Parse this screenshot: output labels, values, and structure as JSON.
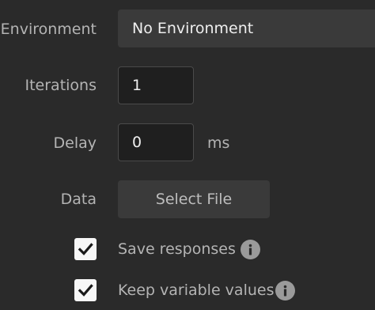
{
  "environment": {
    "label": "Environment",
    "selected": "No Environment"
  },
  "iterations": {
    "label": "Iterations",
    "value": "1"
  },
  "delay": {
    "label": "Delay",
    "value": "0",
    "unit": "ms"
  },
  "data": {
    "label": "Data",
    "button_label": "Select File"
  },
  "options": [
    {
      "label": "Save responses",
      "checked": true
    },
    {
      "label": "Keep variable values",
      "checked": true
    }
  ],
  "icons": {
    "checkmark": "checkmark-icon",
    "info": "info-icon"
  },
  "colors": {
    "background": "#2a2a2a",
    "field_bg": "#1f1f1f",
    "button_bg": "#3a3a3a",
    "checkbox_bg": "#f7f7f7",
    "info_icon_bg": "#9a9a9a"
  }
}
